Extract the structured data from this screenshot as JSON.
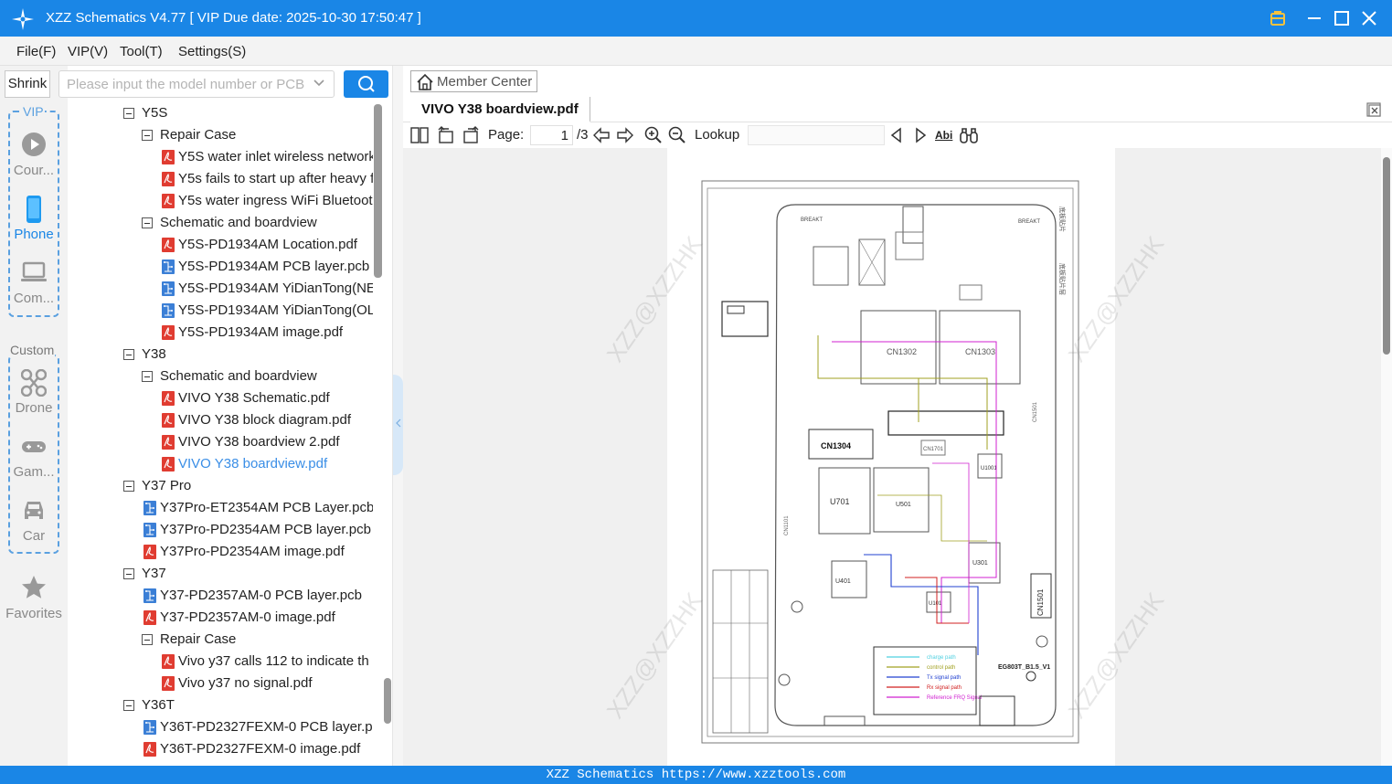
{
  "window": {
    "title": "XZZ Schematics V4.77 [ VIP Due date: 2025-10-30 17:50:47 ]"
  },
  "menu": {
    "items": [
      "File(F)",
      "VIP(V)",
      "Tool(T)",
      "Settings(S)"
    ]
  },
  "sidebar": {
    "shrink_label": "Shrink",
    "search_placeholder": "Please input the model number or PCB",
    "vip_label": "VIP",
    "custom_label": "Custom",
    "vip_items": [
      {
        "label": "Cour...",
        "icon": "play-circle-icon"
      },
      {
        "label": "Phone",
        "icon": "phone-icon"
      },
      {
        "label": "Com...",
        "icon": "laptop-icon"
      }
    ],
    "custom_items": [
      {
        "label": "Drone",
        "icon": "drone-icon"
      },
      {
        "label": "Gam...",
        "icon": "gamepad-icon"
      },
      {
        "label": "Car",
        "icon": "car-icon"
      }
    ],
    "favorites_label": "Favorites"
  },
  "tree": [
    {
      "level": 0,
      "type": "folder",
      "label": "Y5S"
    },
    {
      "level": 1,
      "type": "folder",
      "label": "Repair Case"
    },
    {
      "level": 2,
      "type": "pdf",
      "label": "Y5S water inlet wireless network"
    },
    {
      "level": 2,
      "type": "pdf",
      "label": "Y5s fails to start up after heavy f"
    },
    {
      "level": 2,
      "type": "pdf",
      "label": "Y5s water ingress WiFi Bluetoot"
    },
    {
      "level": 1,
      "type": "folder",
      "label": "Schematic and boardview"
    },
    {
      "level": 2,
      "type": "pdf",
      "label": "Y5S-PD1934AM Location.pdf"
    },
    {
      "level": 2,
      "type": "pcb",
      "label": "Y5S-PD1934AM PCB layer.pcb"
    },
    {
      "level": 2,
      "type": "pcb",
      "label": "Y5S-PD1934AM YiDianTong(NE"
    },
    {
      "level": 2,
      "type": "pcb",
      "label": "Y5S-PD1934AM YiDianTong(OL"
    },
    {
      "level": 2,
      "type": "pdf",
      "label": "Y5S-PD1934AM image.pdf"
    },
    {
      "level": 0,
      "type": "folder",
      "label": "Y38"
    },
    {
      "level": 1,
      "type": "folder",
      "label": "Schematic and boardview"
    },
    {
      "level": 2,
      "type": "pdf",
      "label": "VIVO Y38 Schematic.pdf"
    },
    {
      "level": 2,
      "type": "pdf",
      "label": "VIVO Y38 block diagram.pdf"
    },
    {
      "level": 2,
      "type": "pdf",
      "label": "VIVO Y38 boardview 2.pdf"
    },
    {
      "level": 2,
      "type": "pdf",
      "label": "VIVO Y38 boardview.pdf",
      "selected": true
    },
    {
      "level": 0,
      "type": "folder",
      "label": "Y37 Pro"
    },
    {
      "level": 1,
      "type": "pcb",
      "label": "Y37Pro-ET2354AM PCB Layer.pcb"
    },
    {
      "level": 1,
      "type": "pcb",
      "label": "Y37Pro-PD2354AM PCB layer.pcb"
    },
    {
      "level": 1,
      "type": "pdf",
      "label": "Y37Pro-PD2354AM image.pdf"
    },
    {
      "level": 0,
      "type": "folder",
      "label": "Y37"
    },
    {
      "level": 1,
      "type": "pcb",
      "label": "Y37-PD2357AM-0 PCB layer.pcb"
    },
    {
      "level": 1,
      "type": "pdf",
      "label": "Y37-PD2357AM-0 image.pdf"
    },
    {
      "level": 1,
      "type": "folder",
      "label": "Repair Case"
    },
    {
      "level": 2,
      "type": "pdf",
      "label": "Vivo y37 calls 112 to indicate th"
    },
    {
      "level": 2,
      "type": "pdf",
      "label": "Vivo y37 no signal.pdf"
    },
    {
      "level": 0,
      "type": "folder",
      "label": "Y36T"
    },
    {
      "level": 1,
      "type": "pcb",
      "label": "Y36T-PD2327FEXM-0 PCB layer.pcl"
    },
    {
      "level": 1,
      "type": "pdf",
      "label": "Y36T-PD2327FEXM-0 image.pdf"
    }
  ],
  "viewer": {
    "member_center_label": "Member Center",
    "tab_label": "VIVO Y38 boardview.pdf",
    "page_label": "Page:",
    "page_value": "1",
    "page_total": "/3",
    "lookup_label": "Lookup",
    "lookup_value": "",
    "find_text_label": "Abi"
  },
  "drawing": {
    "watermark": "XZZ@XZZHK",
    "side_text_right_1": "底板贴片",
    "side_text_right_2": "底板贴片层",
    "breakt_left": "BREAKT",
    "breakt_right": "BREAKT",
    "cn1302": "CN1302",
    "cn1303": "CN1303",
    "cn1304": "CN1304",
    "cn1701": "CN1701",
    "u701": "U701",
    "u501": "U501",
    "u401": "U401",
    "u301": "U301",
    "u101": "U101",
    "u1001": "U1001",
    "cn1501": "CN1501",
    "cn1501b": "CN1501",
    "cn1101": "CN1101",
    "board_name": "EG803T_B1.5_V1",
    "legend": [
      {
        "label": "charge path",
        "color": "#4fd0e0"
      },
      {
        "label": "control path",
        "color": "#a0a020"
      },
      {
        "label": "Tx signal path",
        "color": "#2040d0"
      },
      {
        "label": "Rx signal path",
        "color": "#d02020"
      },
      {
        "label": "Reference FRQ Signal",
        "color": "#d020d0"
      }
    ]
  },
  "statusbar": {
    "text": "XZZ Schematics https://www.xzztools.com"
  },
  "colors": {
    "accent": "#1a86e6",
    "selected_text": "#3a8ee6",
    "pdf_icon": "#e03c31",
    "pcb_icon": "#3b7fd6"
  }
}
